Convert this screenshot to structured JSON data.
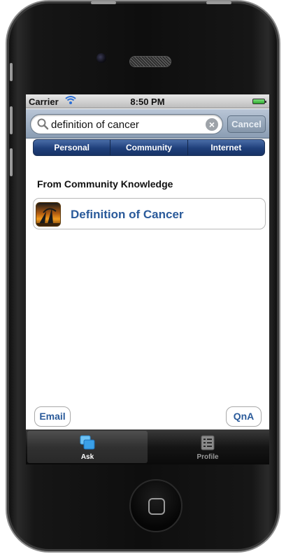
{
  "status_bar": {
    "carrier": "Carrier",
    "time": "8:50 PM",
    "wifi_icon": "wifi-icon",
    "battery_icon": "battery-icon"
  },
  "search": {
    "value": "definition of cancer",
    "cancel_label": "Cancel",
    "clear_glyph": "×"
  },
  "segments": [
    {
      "label": "Personal"
    },
    {
      "label": "Community"
    },
    {
      "label": "Internet"
    }
  ],
  "results": {
    "section_title": "From Community Knowledge",
    "items": [
      {
        "label": "Definition of Cancer",
        "thumbnail_icon": "sunset-thumbnail"
      }
    ]
  },
  "actions": {
    "email_label": "Email",
    "qna_label": "QnA"
  },
  "tab_bar": {
    "tabs": [
      {
        "label": "Ask",
        "icon": "ask-icon",
        "active": true
      },
      {
        "label": "Profile",
        "icon": "profile-icon",
        "active": false
      }
    ]
  },
  "colors": {
    "accent": "#2a5a9a",
    "segment_bg": "#1f3f7a",
    "tab_active_icon": "#3aa0e8"
  }
}
